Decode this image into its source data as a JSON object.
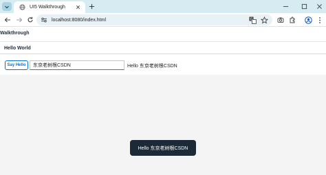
{
  "browser": {
    "tab_title": "UI5 Walkthrough",
    "url": "localhost:8080/index.html",
    "accent_color": "#d6ebf2",
    "icons": [
      "chevron-down-icon",
      "globe-icon",
      "close-icon",
      "plus-icon",
      "minimize-icon",
      "maximize-icon",
      "close-icon",
      "back-arrow-icon",
      "forward-arrow-icon",
      "reload-icon",
      "site-info-icon",
      "translate-icon",
      "star-icon",
      "camera-icon",
      "extensions-icon",
      "profile-icon",
      "more-icon"
    ]
  },
  "app": {
    "title": "Walkthrough",
    "panel_title": "Hello World",
    "button_label": "Say Hello",
    "input_value": "东京老树根CSDN",
    "hello_text": "Hello 东京老树根CSDN",
    "toast_message": "Hello 东京老树根CSDN",
    "button_color": "#0a6ed1",
    "toast_color": "#1b2a36"
  }
}
